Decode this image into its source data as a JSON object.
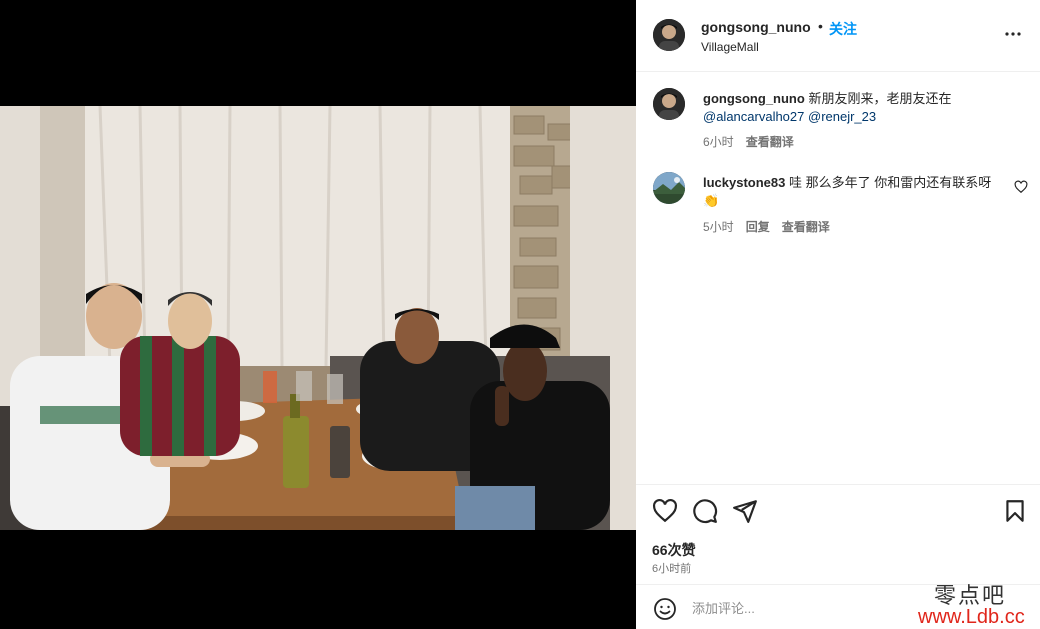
{
  "post": {
    "author": "gongsong_nuno",
    "separator": "•",
    "follow_label": "关注",
    "location": "VillageMall"
  },
  "caption": {
    "author": "gongsong_nuno",
    "text": "新朋友刚来，老朋友还在",
    "mention1": "@alancarvalho27",
    "mention2": "@renejr_23",
    "time": "6小时",
    "translate_label": "查看翻译"
  },
  "comments": [
    {
      "author": "luckystone83",
      "text": "哇 那么多年了 你和雷内还有联系呀 👏",
      "time": "5小时",
      "reply_label": "回复",
      "translate_label": "查看翻译"
    }
  ],
  "stats": {
    "likes": "66次赞",
    "time_ago": "6小时前"
  },
  "add_comment": {
    "placeholder": "添加评论..."
  },
  "watermark": {
    "line1": "零点吧",
    "line2": "www.Ldb.cc"
  },
  "icons": {
    "more": "more-icon",
    "like": "heart-icon",
    "comment": "comment-icon",
    "share": "send-icon",
    "save": "bookmark-icon",
    "emoji": "emoji-icon"
  },
  "colors": {
    "link": "#0095f6",
    "mention": "#00376b",
    "text": "#262626",
    "muted": "#737373"
  }
}
